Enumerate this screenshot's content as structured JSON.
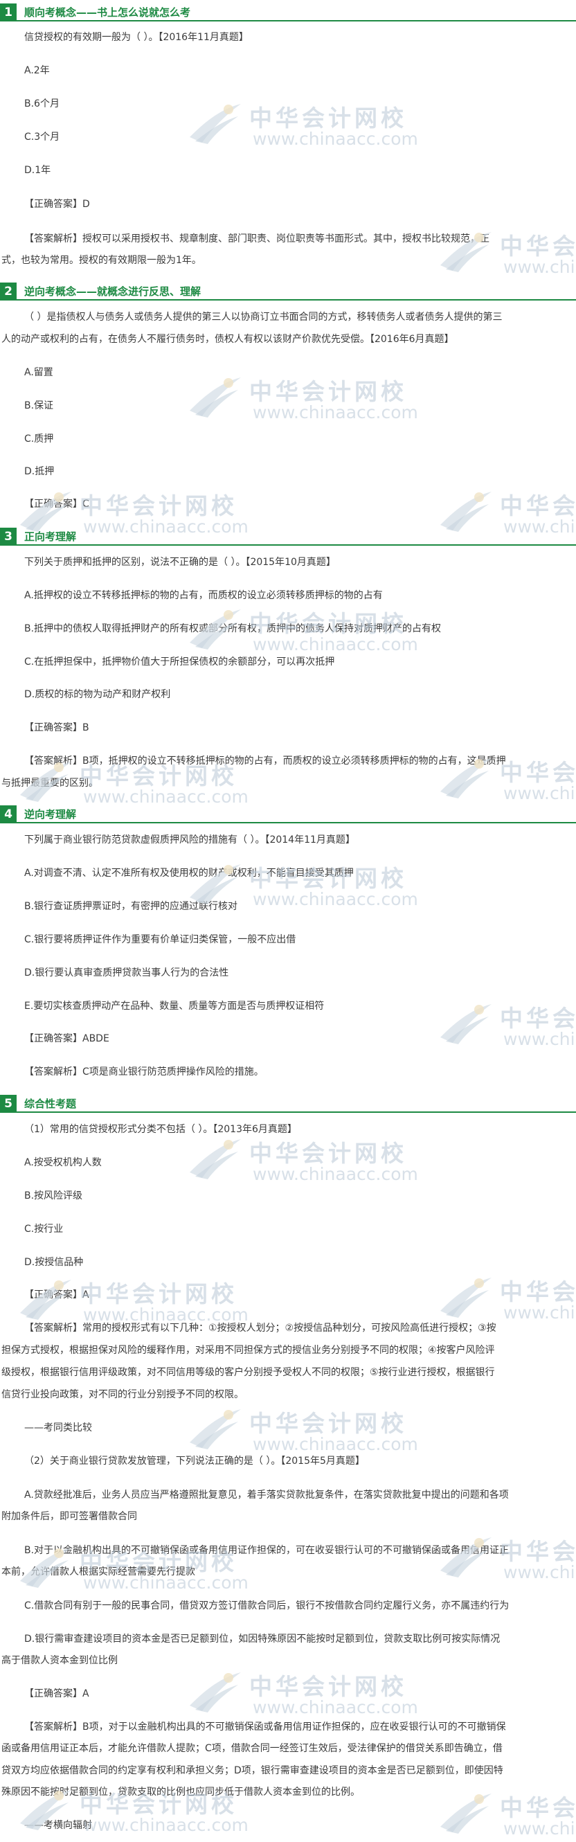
{
  "watermark": {
    "cn": "中华会计网校",
    "url": "www.chinaacc.com"
  },
  "sections": [
    {
      "num": "1",
      "title": "顺向考概念——书上怎么说就怎么考",
      "question": "信贷授权的有效期一般为（ ）。【2016年11月真题】",
      "options": [
        "A.2年",
        "B.6个月",
        "C.3个月",
        "D.1年"
      ],
      "answer": "【正确答案】D",
      "analysis": [
        "【答案解析】授权可以采用授权书、规章制度、部门职责、岗位职责等书面形式。其中，授权书比较规范，正",
        "式，也较为常用。授权的有效期限一般为1年。"
      ]
    },
    {
      "num": "2",
      "title": "逆向考概念——就概念进行反思、理解",
      "question": [
        "（ ）是指债权人与债务人或债务人提供的第三人以协商订立书面合同的方式，移转债务人或者债务人提供的第三",
        "人的动产或权利的占有，在债务人不履行债务时，债权人有权以该财产价款优先受偿。【2016年6月真题】"
      ],
      "options": [
        "A.留置",
        "B.保证",
        "C.质押",
        "D.抵押"
      ],
      "answer": "【正确答案】C"
    },
    {
      "num": "3",
      "title": "正向考理解",
      "question": "下列关于质押和抵押的区别，说法不正确的是（ ）。【2015年10月真题】",
      "options": [
        "A.抵押权的设立不转移抵押标的物的占有，而质权的设立必须转移质押标的物的占有",
        "B.抵押中的债权人取得抵押财产的所有权或部分所有权，质押中的债务人保持对质押财产的占有权",
        "C.在抵押担保中，抵押物价值大于所担保债权的余额部分，可以再次抵押",
        "D.质权的标的物为动产和财产权利"
      ],
      "answer": "【正确答案】B",
      "analysis": [
        "【答案解析】B项，抵押权的设立不转移抵押标的物的占有，而质权的设立必须转移质押标的物的占有，这是质押",
        "与抵押最重要的区别。"
      ]
    },
    {
      "num": "4",
      "title": "逆向考理解",
      "question": "下列属于商业银行防范贷款虚假质押风险的措施有（ ）。【2014年11月真题】",
      "options": [
        "A.对调查不清、认定不准所有权及使用权的财产或权利，不能盲目接受其质押",
        "B.银行查证质押票证时，有密押的应通过联行核对",
        "C.银行要将质押证件作为重要有价单证归类保管，一般不应出借",
        "D.银行要认真审查质押贷款当事人行为的合法性",
        "E.要切实核查质押动产在品种、数量、质量等方面是否与质押权证相符"
      ],
      "answer": "【正确答案】ABDE",
      "analysis": [
        "【答案解析】C项是商业银行防范质押操作风险的措施。"
      ]
    },
    {
      "num": "5",
      "title": "综合性考题",
      "q1": {
        "question": "（1）常用的信贷授权形式分类不包括（ ）。【2013年6月真题】",
        "options": [
          "A.按受权机构人数",
          "B.按风险评级",
          "C.按行业",
          "D.按授信品种"
        ],
        "answer": "【正确答案】A",
        "analysis": [
          "【答案解析】常用的授权形式有以下几种：①按授权人划分；②按授信品种划分，可按风险高低进行授权；③按",
          "担保方式授权，根据担保对风险的缓释作用，对采用不同担保方式的授信业务分别授予不同的权限；④按客户风险评",
          "级授权，根据银行信用评级政策，对不同信用等级的客户分别授予受权人不同的权限；⑤按行业进行授权，根据银行",
          "信贷行业投向政策，对不同的行业分别授予不同的权限。"
        ],
        "note": "——考同类比较"
      },
      "q2": {
        "question": "（2）关于商业银行贷款发放管理，下列说法正确的是（ ）。【2015年5月真题】",
        "options": [
          [
            "A.贷款经批准后，业务人员应当严格遵照批复意见，着手落实贷款批复条件，在落实贷款批复中提出的问题和各项",
            "附加条件后，即可签署借款合同"
          ],
          [
            "B.对于以金融机构出具的不可撤销保函或备用信用证作担保的，可在收妥银行认可的不可撤销保函或备用信用证正",
            "本前，允许借款人根据实际经营需要先行提款"
          ],
          [
            "C.借款合同有别于一般的民事合同，借贷双方签订借款合同后，银行不按借款合同约定履行义务，亦不属违约行为"
          ],
          [
            "D.银行需审查建设项目的资本金是否已足额到位，如因特殊原因不能按时足额到位，贷款支取比例可按实际情况",
            "高于借款人资本金到位比例"
          ]
        ],
        "answer": "【正确答案】A",
        "analysis": [
          "【答案解析】B项，对于以金融机构出具的不可撤销保函或备用信用证作担保的，应在收妥银行认可的不可撤销保",
          "函或备用信用证正本后，才能允许借款人提款；C项，借款合同一经签订生效后，受法律保护的借贷关系即告确立，借",
          "贷双方均应依据借款合同的约定享有权利和承担义务；D项，银行需审查建设项目的资本金是否已足额到位，即使因特",
          "殊原因不能按时足额到位，贷款支取的比例也应同步低于借款人资本金到位的比例。"
        ],
        "note": "——考横向辐射"
      }
    }
  ]
}
